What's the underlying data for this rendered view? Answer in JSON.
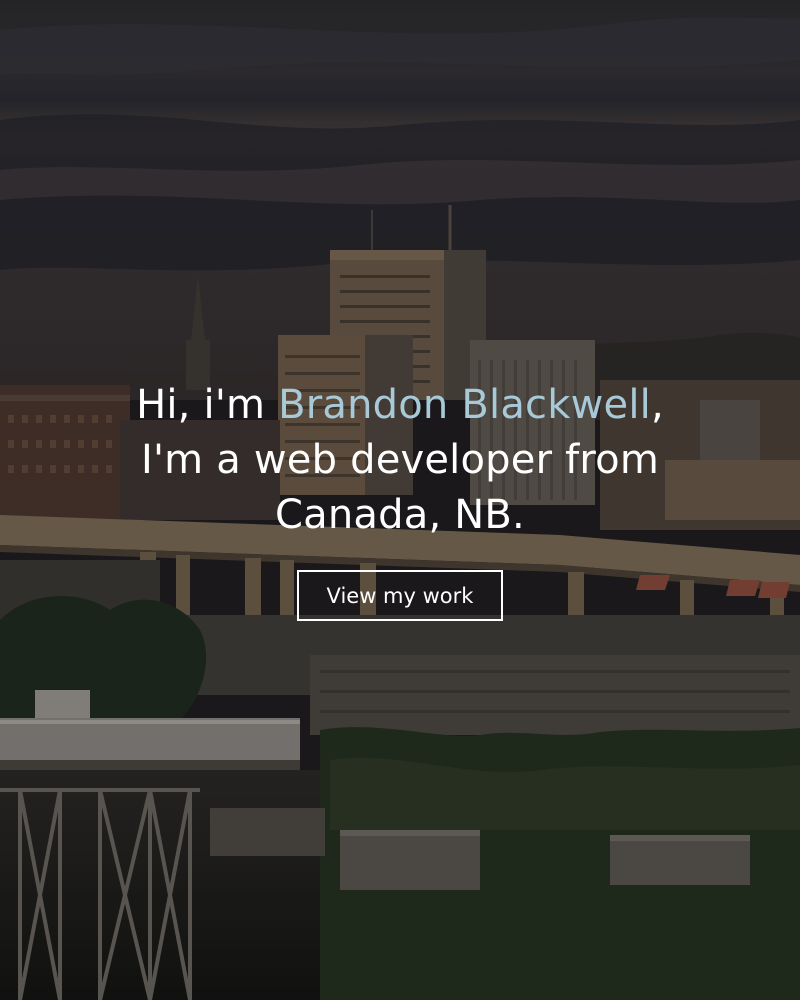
{
  "hero": {
    "greeting": "Hi, i'm ",
    "name": "Brandon Blackwell",
    "name_suffix": ",",
    "line2": "I'm a web developer from",
    "line3": "Canada, NB.",
    "cta_label": "View my work"
  },
  "colors": {
    "accent_name": "#a8c9d8",
    "text": "#ffffff",
    "button_border": "#ffffff"
  }
}
